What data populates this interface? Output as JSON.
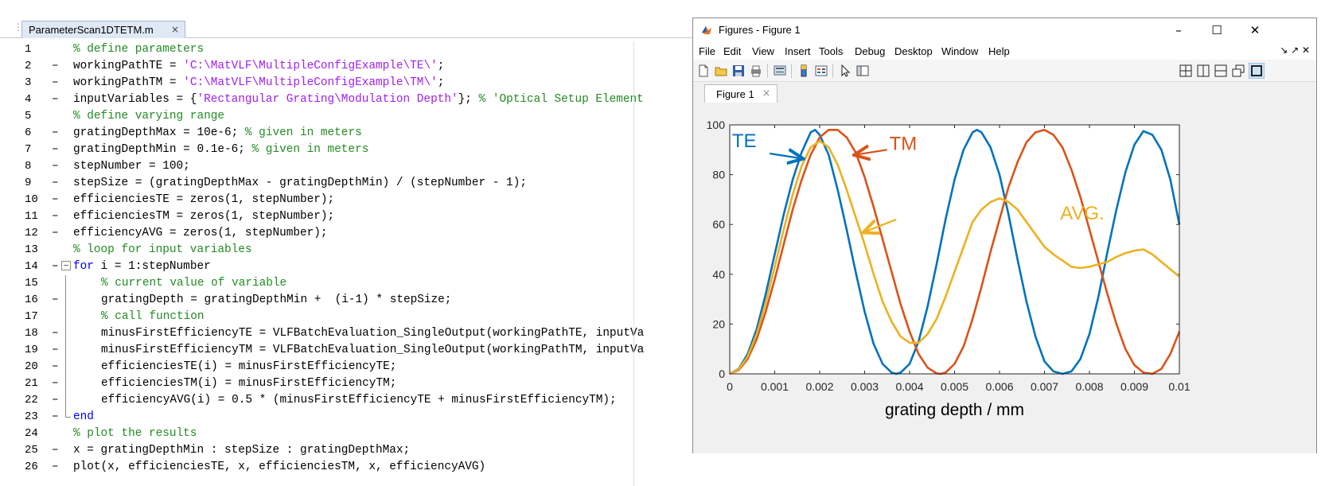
{
  "editor": {
    "tab_label": "ParameterScan1DTETM.m",
    "tab_close": "×",
    "grip": "⋮",
    "lines": [
      {
        "n": "1",
        "exec": false,
        "segments": [
          {
            "t": "% define parameters",
            "c": "cm"
          }
        ]
      },
      {
        "n": "2",
        "exec": true,
        "segments": [
          {
            "t": "workingPathTE = ",
            "c": ""
          },
          {
            "t": "'C:\\MatVLF\\MultipleConfigExample\\TE\\'",
            "c": "str"
          },
          {
            "t": ";",
            "c": ""
          }
        ]
      },
      {
        "n": "3",
        "exec": true,
        "segments": [
          {
            "t": "workingPathTM = ",
            "c": ""
          },
          {
            "t": "'C:\\MatVLF\\MultipleConfigExample\\TM\\'",
            "c": "str"
          },
          {
            "t": ";",
            "c": ""
          }
        ]
      },
      {
        "n": "4",
        "exec": true,
        "segments": [
          {
            "t": "inputVariables = {",
            "c": ""
          },
          {
            "t": "'Rectangular Grating\\Modulation Depth'",
            "c": "str"
          },
          {
            "t": "}; ",
            "c": ""
          },
          {
            "t": "% 'Optical Setup Element",
            "c": "cm"
          }
        ]
      },
      {
        "n": "5",
        "exec": false,
        "segments": [
          {
            "t": "% define varying range",
            "c": "cm"
          }
        ]
      },
      {
        "n": "6",
        "exec": true,
        "segments": [
          {
            "t": "gratingDepthMax = 10e-6; ",
            "c": ""
          },
          {
            "t": "% given in meters",
            "c": "cm"
          }
        ]
      },
      {
        "n": "7",
        "exec": true,
        "segments": [
          {
            "t": "gratingDepthMin = 0.1e-6; ",
            "c": ""
          },
          {
            "t": "% given in meters",
            "c": "cm"
          }
        ]
      },
      {
        "n": "8",
        "exec": true,
        "segments": [
          {
            "t": "stepNumber = 100;",
            "c": ""
          }
        ]
      },
      {
        "n": "9",
        "exec": true,
        "segments": [
          {
            "t": "stepSize = (gratingDepthMax - gratingDepthMin) / (stepNumber - 1);",
            "c": ""
          }
        ]
      },
      {
        "n": "10",
        "exec": true,
        "segments": [
          {
            "t": "efficienciesTE = zeros(1, stepNumber);",
            "c": ""
          }
        ]
      },
      {
        "n": "11",
        "exec": true,
        "segments": [
          {
            "t": "efficienciesTM = zeros(1, stepNumber);",
            "c": ""
          }
        ]
      },
      {
        "n": "12",
        "exec": true,
        "segments": [
          {
            "t": "efficiencyAVG = zeros(1, stepNumber);",
            "c": ""
          }
        ]
      },
      {
        "n": "13",
        "exec": false,
        "segments": [
          {
            "t": "% loop for input variables",
            "c": "cm"
          }
        ]
      },
      {
        "n": "14",
        "exec": true,
        "fold": "start",
        "segments": [
          {
            "t": "for",
            "c": "kw"
          },
          {
            "t": " i = 1:stepNumber",
            "c": ""
          }
        ]
      },
      {
        "n": "15",
        "exec": false,
        "fold": "mid",
        "indent": true,
        "segments": [
          {
            "t": "% current value of variable",
            "c": "cm"
          }
        ]
      },
      {
        "n": "16",
        "exec": true,
        "fold": "mid",
        "indent": true,
        "segments": [
          {
            "t": "gratingDepth = gratingDepthMin +  (i-1) * stepSize;",
            "c": ""
          }
        ]
      },
      {
        "n": "17",
        "exec": false,
        "fold": "mid",
        "indent": true,
        "segments": [
          {
            "t": "% call function",
            "c": "cm"
          }
        ]
      },
      {
        "n": "18",
        "exec": true,
        "fold": "mid",
        "indent": true,
        "segments": [
          {
            "t": "minusFirstEfficiencyTE = VLFBatchEvaluation_SingleOutput(workingPathTE, inputVa",
            "c": ""
          }
        ]
      },
      {
        "n": "19",
        "exec": true,
        "fold": "mid",
        "indent": true,
        "segments": [
          {
            "t": "minusFirstEfficiencyTM = VLFBatchEvaluation_SingleOutput(workingPathTM, inputVa",
            "c": ""
          }
        ]
      },
      {
        "n": "20",
        "exec": true,
        "fold": "mid",
        "indent": true,
        "segments": [
          {
            "t": "efficienciesTE(i) = minusFirstEfficiencyTE;",
            "c": ""
          }
        ]
      },
      {
        "n": "21",
        "exec": true,
        "fold": "mid",
        "indent": true,
        "segments": [
          {
            "t": "efficienciesTM(i) = minusFirstEfficiencyTM;",
            "c": ""
          }
        ]
      },
      {
        "n": "22",
        "exec": true,
        "fold": "mid",
        "indent": true,
        "segments": [
          {
            "t": "efficiencyAVG(i) = 0.5 * (minusFirstEfficiencyTE + minusFirstEfficiencyTM);",
            "c": ""
          }
        ]
      },
      {
        "n": "23",
        "exec": true,
        "fold": "end",
        "segments": [
          {
            "t": "end",
            "c": "kw"
          }
        ]
      },
      {
        "n": "24",
        "exec": false,
        "segments": [
          {
            "t": "% plot the results",
            "c": "cm"
          }
        ]
      },
      {
        "n": "25",
        "exec": true,
        "segments": [
          {
            "t": "x = gratingDepthMin : stepSize : gratingDepthMax;",
            "c": ""
          }
        ]
      },
      {
        "n": "26",
        "exec": true,
        "segments": [
          {
            "t": "plot(x, efficienciesTE, x, efficienciesTM, x, efficiencyAVG)",
            "c": ""
          }
        ]
      }
    ],
    "exec_marker": "–",
    "fold_minus": "−",
    "colors": {
      "comment": "#228b22",
      "string": "#a020f0",
      "keyword": "#0000ff"
    }
  },
  "figure_window": {
    "title": "Figures - Figure 1",
    "window_buttons": {
      "minimize": "–",
      "maximize": "☐",
      "close": "✕"
    },
    "menus": [
      "File",
      "Edit",
      "View",
      "Insert",
      "Tools",
      "Debug",
      "Desktop",
      "Window",
      "Help"
    ],
    "menubar_icons": "↘ ↗ ✕",
    "toolbar_icons": [
      "new-file-icon",
      "open-folder-icon",
      "save-icon",
      "print-icon",
      "print-preview-icon",
      "colorbar-icon",
      "legend-icon",
      "pointer-icon",
      "property-editor-icon",
      "tile-grid-icon",
      "tile-columns-icon",
      "tile-rows-icon",
      "float-icon",
      "maximize-icon"
    ],
    "figure_tab": "Figure 1",
    "figure_tab_close": "×"
  },
  "chart_data": {
    "type": "line",
    "title": "",
    "xlabel": "grating depth / mm",
    "ylabel": "",
    "xlim": [
      0,
      0.01
    ],
    "ylim": [
      0,
      100
    ],
    "xticks": [
      "0",
      "0.001",
      "0.002",
      "0.003",
      "0.004",
      "0.005",
      "0.006",
      "0.007",
      "0.008",
      "0.009",
      "0.01"
    ],
    "yticks": [
      "0",
      "20",
      "40",
      "60",
      "80",
      "100"
    ],
    "grid": false,
    "series": [
      {
        "name": "TE",
        "color": "#0072bd",
        "points": [
          [
            0,
            0
          ],
          [
            0.0002,
            2
          ],
          [
            0.0004,
            8
          ],
          [
            0.0006,
            18
          ],
          [
            0.0008,
            32
          ],
          [
            0.001,
            48
          ],
          [
            0.0012,
            64
          ],
          [
            0.0014,
            78
          ],
          [
            0.0016,
            89
          ],
          [
            0.0018,
            97
          ],
          [
            0.0019,
            98
          ],
          [
            0.002,
            96
          ],
          [
            0.0022,
            88
          ],
          [
            0.0024,
            74
          ],
          [
            0.0026,
            58
          ],
          [
            0.0028,
            41
          ],
          [
            0.003,
            25
          ],
          [
            0.0032,
            12
          ],
          [
            0.0034,
            4
          ],
          [
            0.0036,
            0.5
          ],
          [
            0.0037,
            0
          ],
          [
            0.0038,
            0.5
          ],
          [
            0.004,
            4
          ],
          [
            0.0042,
            13
          ],
          [
            0.0044,
            27
          ],
          [
            0.0046,
            44
          ],
          [
            0.0048,
            62
          ],
          [
            0.005,
            78
          ],
          [
            0.0052,
            90
          ],
          [
            0.0054,
            97
          ],
          [
            0.0055,
            98
          ],
          [
            0.0056,
            97
          ],
          [
            0.0058,
            91
          ],
          [
            0.006,
            80
          ],
          [
            0.0062,
            64
          ],
          [
            0.0064,
            46
          ],
          [
            0.0066,
            29
          ],
          [
            0.0068,
            15
          ],
          [
            0.007,
            5
          ],
          [
            0.0072,
            1
          ],
          [
            0.0074,
            0
          ],
          [
            0.0076,
            1
          ],
          [
            0.0078,
            6
          ],
          [
            0.008,
            16
          ],
          [
            0.0082,
            31
          ],
          [
            0.0084,
            49
          ],
          [
            0.0086,
            66
          ],
          [
            0.0088,
            81
          ],
          [
            0.009,
            92
          ],
          [
            0.0092,
            97.5
          ],
          [
            0.0094,
            96
          ],
          [
            0.0096,
            90
          ],
          [
            0.0098,
            78
          ],
          [
            0.01,
            60
          ]
        ]
      },
      {
        "name": "TM",
        "color": "#d95319",
        "points": [
          [
            0,
            0
          ],
          [
            0.0002,
            1.5
          ],
          [
            0.0004,
            6
          ],
          [
            0.0006,
            14
          ],
          [
            0.0008,
            25
          ],
          [
            0.001,
            38
          ],
          [
            0.0012,
            52
          ],
          [
            0.0014,
            66
          ],
          [
            0.0016,
            78
          ],
          [
            0.0018,
            88
          ],
          [
            0.002,
            95
          ],
          [
            0.0022,
            98
          ],
          [
            0.0024,
            98
          ],
          [
            0.0026,
            95
          ],
          [
            0.0028,
            89
          ],
          [
            0.003,
            79
          ],
          [
            0.0032,
            67
          ],
          [
            0.0034,
            54
          ],
          [
            0.0036,
            41
          ],
          [
            0.0038,
            28
          ],
          [
            0.004,
            17
          ],
          [
            0.0042,
            8
          ],
          [
            0.0044,
            2.5
          ],
          [
            0.0046,
            0.2
          ],
          [
            0.0047,
            0
          ],
          [
            0.0048,
            0.5
          ],
          [
            0.005,
            4
          ],
          [
            0.0052,
            11
          ],
          [
            0.0054,
            22
          ],
          [
            0.0056,
            35
          ],
          [
            0.0058,
            49
          ],
          [
            0.006,
            62
          ],
          [
            0.0062,
            75
          ],
          [
            0.0064,
            85
          ],
          [
            0.0066,
            93
          ],
          [
            0.0068,
            97
          ],
          [
            0.007,
            98
          ],
          [
            0.0072,
            96
          ],
          [
            0.0074,
            91
          ],
          [
            0.0076,
            82
          ],
          [
            0.0078,
            71
          ],
          [
            0.008,
            58
          ],
          [
            0.0082,
            45
          ],
          [
            0.0084,
            32
          ],
          [
            0.0086,
            20
          ],
          [
            0.0088,
            10
          ],
          [
            0.009,
            3.5
          ],
          [
            0.0092,
            0.5
          ],
          [
            0.0094,
            0
          ],
          [
            0.0096,
            2
          ],
          [
            0.0098,
            8
          ],
          [
            0.01,
            17
          ]
        ]
      },
      {
        "name": "AVG.",
        "color": "#edb120",
        "points": [
          [
            0,
            0
          ],
          [
            0.0002,
            1.8
          ],
          [
            0.0004,
            7
          ],
          [
            0.0006,
            16
          ],
          [
            0.0008,
            28.5
          ],
          [
            0.001,
            43
          ],
          [
            0.0012,
            58
          ],
          [
            0.0014,
            72
          ],
          [
            0.0016,
            83.5
          ],
          [
            0.0018,
            91
          ],
          [
            0.002,
            93.5
          ],
          [
            0.0022,
            91
          ],
          [
            0.0024,
            84
          ],
          [
            0.0026,
            74
          ],
          [
            0.0028,
            63
          ],
          [
            0.003,
            52
          ],
          [
            0.0032,
            40
          ],
          [
            0.0034,
            29
          ],
          [
            0.0036,
            21
          ],
          [
            0.0038,
            15
          ],
          [
            0.004,
            12.5
          ],
          [
            0.0042,
            12.5
          ],
          [
            0.0044,
            16
          ],
          [
            0.0046,
            22
          ],
          [
            0.0048,
            31
          ],
          [
            0.005,
            41
          ],
          [
            0.0052,
            51
          ],
          [
            0.0054,
            61
          ],
          [
            0.0056,
            66
          ],
          [
            0.0058,
            69
          ],
          [
            0.006,
            70.5
          ],
          [
            0.0062,
            69
          ],
          [
            0.0064,
            66
          ],
          [
            0.0066,
            61
          ],
          [
            0.0068,
            56
          ],
          [
            0.007,
            51
          ],
          [
            0.0072,
            48
          ],
          [
            0.0074,
            45.5
          ],
          [
            0.0076,
            43
          ],
          [
            0.0078,
            42.5
          ],
          [
            0.008,
            43
          ],
          [
            0.0082,
            44
          ],
          [
            0.0084,
            45
          ],
          [
            0.0086,
            47
          ],
          [
            0.0088,
            48.5
          ],
          [
            0.009,
            49.5
          ],
          [
            0.0092,
            50
          ],
          [
            0.0094,
            48
          ],
          [
            0.0096,
            45
          ],
          [
            0.0098,
            42
          ],
          [
            0.01,
            39
          ]
        ]
      }
    ],
    "annotations": [
      {
        "text": "TE",
        "color": "#0072bd",
        "tx": 5e-05,
        "ty": 91,
        "ax": [
          0.00089,
          88.5
        ],
        "ah": [
          0.0016,
          86.5
        ]
      },
      {
        "text": "TM",
        "color": "#d95319",
        "tx": 0.00355,
        "ty": 90,
        "ax": [
          0.0035,
          90
        ],
        "ah": [
          0.0028,
          88
        ]
      },
      {
        "text": "AVG.",
        "color": "#edb120",
        "tx": 0.00735,
        "ty": 62,
        "ax": [
          0.0037,
          62
        ],
        "ah": [
          0.003,
          57
        ]
      }
    ]
  }
}
